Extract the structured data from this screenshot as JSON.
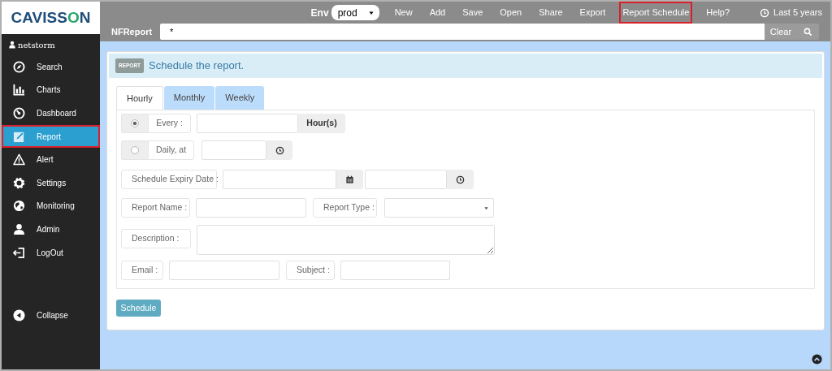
{
  "logo": {
    "text": "CAVISSON"
  },
  "user": {
    "name": "netstorm"
  },
  "sidebar": {
    "items": [
      {
        "label": "Search",
        "selected": false,
        "highlighted": false
      },
      {
        "label": "Charts",
        "selected": false,
        "highlighted": false
      },
      {
        "label": "Dashboard",
        "selected": false,
        "highlighted": false
      },
      {
        "label": "Report",
        "selected": true,
        "highlighted": true
      },
      {
        "label": "Alert",
        "selected": false,
        "highlighted": false
      },
      {
        "label": "Settings",
        "selected": false,
        "highlighted": false
      },
      {
        "label": "Monitoring",
        "selected": false,
        "highlighted": false
      },
      {
        "label": "Admin",
        "selected": false,
        "highlighted": false
      },
      {
        "label": "LogOut",
        "selected": false,
        "highlighted": false
      }
    ],
    "collapse": "Collapse"
  },
  "toolbar": {
    "env_label": "Env",
    "env_value": "prod",
    "menu": [
      {
        "label": "New",
        "highlighted": false
      },
      {
        "label": "Add",
        "highlighted": false
      },
      {
        "label": "Save",
        "highlighted": false
      },
      {
        "label": "Open",
        "highlighted": false
      },
      {
        "label": "Share",
        "highlighted": false
      },
      {
        "label": "Export",
        "highlighted": false
      },
      {
        "label": "Report Schedule",
        "highlighted": true
      },
      {
        "label": "Help?",
        "highlighted": false
      }
    ],
    "time_range": "Last 5 years"
  },
  "query_bar": {
    "label": "NFReport",
    "value": "*",
    "clear": "Clear"
  },
  "panel": {
    "badge": "REPORT",
    "title": "Schedule the report.",
    "tabs": [
      {
        "label": "Hourly",
        "selected": true
      },
      {
        "label": "Monthly",
        "selected": false
      },
      {
        "label": "Weekly",
        "selected": false
      }
    ],
    "every": {
      "label": "Every :",
      "selected": true,
      "unit": "Hour(s)"
    },
    "daily": {
      "label": "Daily, at",
      "selected": false
    },
    "expiry_label": "Schedule Expiry Date :",
    "report_name_label": "Report Name :",
    "report_type_label": "Report Type :",
    "description_label": "Description :",
    "email_label": "Email :",
    "subject_label": "Subject :",
    "submit": "Schedule"
  }
}
